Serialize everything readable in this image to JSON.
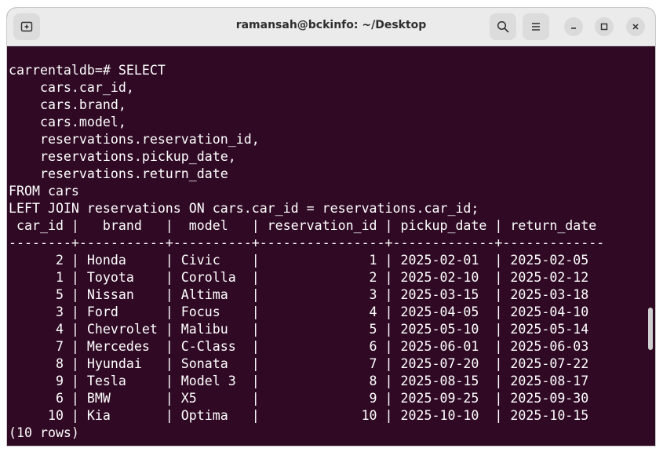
{
  "window": {
    "title": "ramansah@bckinfo: ~/Desktop"
  },
  "titlebar": {
    "new_tab_icon": "new-tab-icon",
    "search_icon": "search-icon",
    "menu_icon": "hamburger-menu-icon",
    "minimize_icon": "minimize-icon",
    "maximize_icon": "maximize-icon",
    "close_icon": "close-icon"
  },
  "terminal": {
    "lines": [
      "carrentaldb=# SELECT",
      "    cars.car_id,",
      "    cars.brand,",
      "    cars.model,",
      "    reservations.reservation_id,",
      "    reservations.pickup_date,",
      "    reservations.return_date",
      "FROM cars",
      "LEFT JOIN reservations ON cars.car_id = reservations.car_id;",
      " car_id |   brand   |  model   | reservation_id | pickup_date | return_date",
      "--------+-----------+----------+----------------+-------------+-------------",
      "      2 | Honda     | Civic    |              1 | 2025-02-01  | 2025-02-05",
      "      1 | Toyota    | Corolla  |              2 | 2025-02-10  | 2025-02-12",
      "      5 | Nissan    | Altima   |              3 | 2025-03-15  | 2025-03-18",
      "      3 | Ford      | Focus    |              4 | 2025-04-05  | 2025-04-10",
      "      4 | Chevrolet | Malibu   |              5 | 2025-05-10  | 2025-05-14",
      "      7 | Mercedes  | C-Class  |              6 | 2025-06-01  | 2025-06-03",
      "      8 | Hyundai   | Sonata   |              7 | 2025-07-20  | 2025-07-22",
      "      9 | Tesla     | Model 3  |              8 | 2025-08-15  | 2025-08-17",
      "      6 | BMW       | X5       |              9 | 2025-09-25  | 2025-09-30",
      "     10 | Kia       | Optima   |             10 | 2025-10-10  | 2025-10-15",
      "(10 rows)"
    ]
  },
  "colors": {
    "terminal_bg": "#300a24",
    "terminal_fg": "#ffffff",
    "titlebar_bg": "#ebebeb"
  }
}
